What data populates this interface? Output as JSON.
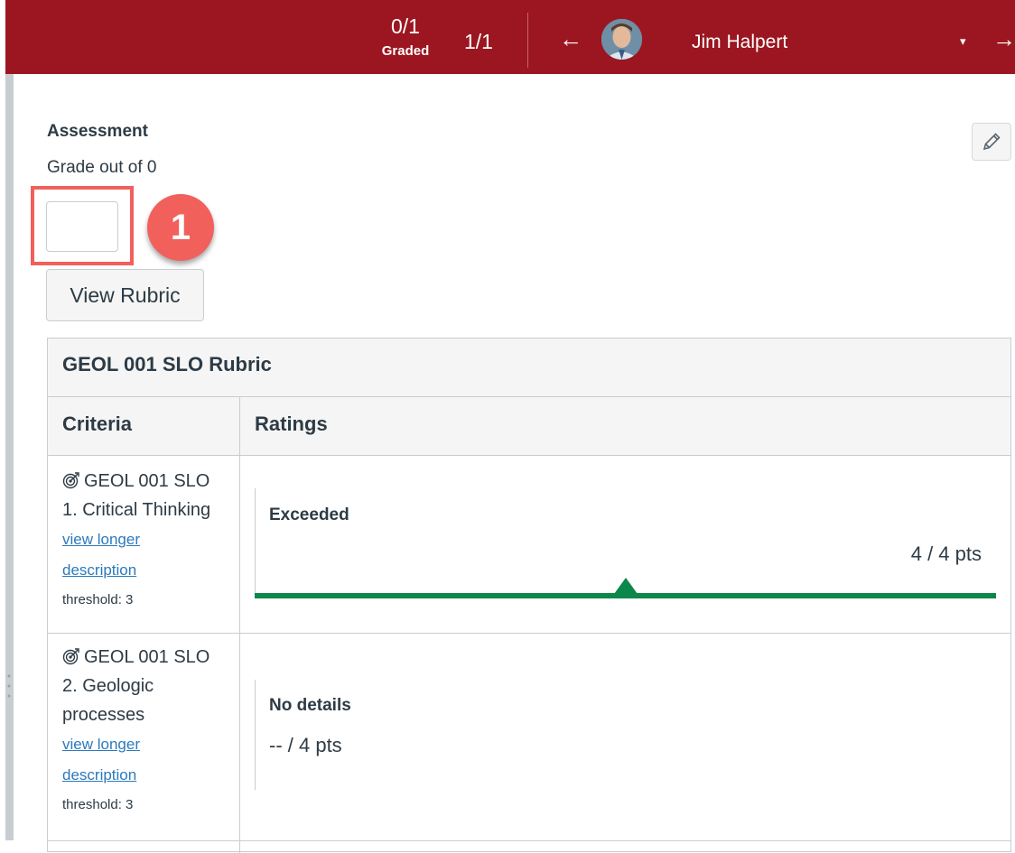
{
  "header": {
    "graded_count": "0/1",
    "graded_label": "Graded",
    "position": "1/1",
    "prev_arrow": "←",
    "next_arrow": "→",
    "student_name": "Jim Halpert",
    "dropdown_glyph": "▾",
    "avatar_icon": "student-avatar",
    "background_color": "#9b1620"
  },
  "assessment": {
    "title": "Assessment",
    "grade_out_of": "Grade out of 0",
    "grade_value": "",
    "callout_number": "1",
    "callout_color": "#f2605b",
    "view_rubric_label": "View Rubric",
    "edit_icon": "pencil-icon"
  },
  "rubric": {
    "title": "GEOL 001 SLO Rubric",
    "columns": {
      "criteria": "Criteria",
      "ratings": "Ratings"
    },
    "rows": [
      {
        "criterion_line1": "GEOL 001 SLO",
        "criterion_line2": "1. Critical Thinking",
        "criterion_line3": "",
        "link_line1": "view longer",
        "link_line2": "description",
        "threshold": "threshold: 3",
        "rating_name": "Exceeded",
        "points": "4 / 4 pts",
        "mastery_color": "#0b874b",
        "icon": "outcome-target-icon"
      },
      {
        "criterion_line1": "GEOL 001 SLO",
        "criterion_line2": "2. Geologic",
        "criterion_line3": "processes",
        "link_line1": "view longer",
        "link_line2": "description",
        "threshold": "threshold: 3",
        "rating_name": "No details",
        "points": "-- / 4 pts",
        "icon": "outcome-target-icon"
      }
    ]
  }
}
